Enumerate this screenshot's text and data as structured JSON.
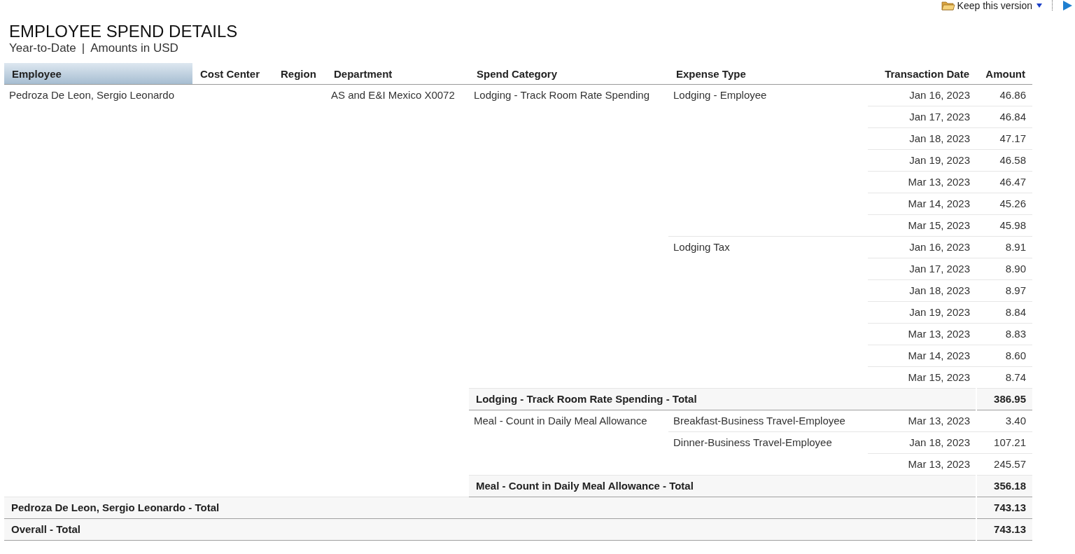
{
  "toolbar": {
    "keep_version_label": "Keep this version"
  },
  "report": {
    "title": "EMPLOYEE SPEND DETAILS",
    "subtitle_period": "Year-to-Date",
    "subtitle_separator": "|",
    "subtitle_currency": "Amounts in USD"
  },
  "table": {
    "columns": [
      {
        "label": "Employee",
        "highlighted": true
      },
      {
        "label": "Cost Center",
        "highlighted": false
      },
      {
        "label": "Region",
        "highlighted": false
      },
      {
        "label": "Department",
        "highlighted": false
      },
      {
        "label": "Spend Category",
        "highlighted": false
      },
      {
        "label": "Expense Type",
        "highlighted": false
      },
      {
        "label": "Transaction Date",
        "highlighted": false
      },
      {
        "label": "Amount",
        "highlighted": false
      }
    ],
    "employees": [
      {
        "name": "Pedroza De Leon, Sergio Leonardo",
        "department": "AS and E&I Mexico X0072",
        "categories": [
          {
            "name": "Lodging - Track Room Rate Spending",
            "expense_types": [
              {
                "name": "Lodging - Employee",
                "rows": [
                  {
                    "date": "Jan 16, 2023",
                    "amount": "46.86"
                  },
                  {
                    "date": "Jan 17, 2023",
                    "amount": "46.84"
                  },
                  {
                    "date": "Jan 18, 2023",
                    "amount": "47.17"
                  },
                  {
                    "date": "Jan 19, 2023",
                    "amount": "46.58"
                  },
                  {
                    "date": "Mar 13, 2023",
                    "amount": "46.47"
                  },
                  {
                    "date": "Mar 14, 2023",
                    "amount": "45.26"
                  },
                  {
                    "date": "Mar 15, 2023",
                    "amount": "45.98"
                  }
                ]
              },
              {
                "name": "Lodging Tax",
                "rows": [
                  {
                    "date": "Jan 16, 2023",
                    "amount": "8.91"
                  },
                  {
                    "date": "Jan 17, 2023",
                    "amount": "8.90"
                  },
                  {
                    "date": "Jan 18, 2023",
                    "amount": "8.97"
                  },
                  {
                    "date": "Jan 19, 2023",
                    "amount": "8.84"
                  },
                  {
                    "date": "Mar 13, 2023",
                    "amount": "8.83"
                  },
                  {
                    "date": "Mar 14, 2023",
                    "amount": "8.60"
                  },
                  {
                    "date": "Mar 15, 2023",
                    "amount": "8.74"
                  }
                ]
              }
            ],
            "total_label": "Lodging - Track Room Rate Spending - Total",
            "total": "386.95"
          },
          {
            "name": "Meal - Count in Daily Meal Allowance",
            "expense_types": [
              {
                "name": "Breakfast-Business Travel-Employee",
                "rows": [
                  {
                    "date": "Mar 13, 2023",
                    "amount": "3.40"
                  }
                ]
              },
              {
                "name": "Dinner-Business Travel-Employee",
                "rows": [
                  {
                    "date": "Jan 18, 2023",
                    "amount": "107.21"
                  },
                  {
                    "date": "Mar 13, 2023",
                    "amount": "245.57"
                  }
                ]
              }
            ],
            "total_label": "Meal - Count in Daily Meal Allowance - Total",
            "total": "356.18"
          }
        ],
        "total_label": "Pedroza De Leon, Sergio Leonardo - Total",
        "total": "743.13"
      }
    ],
    "overall": {
      "label": "Overall - Total",
      "total": "743.13"
    }
  }
}
